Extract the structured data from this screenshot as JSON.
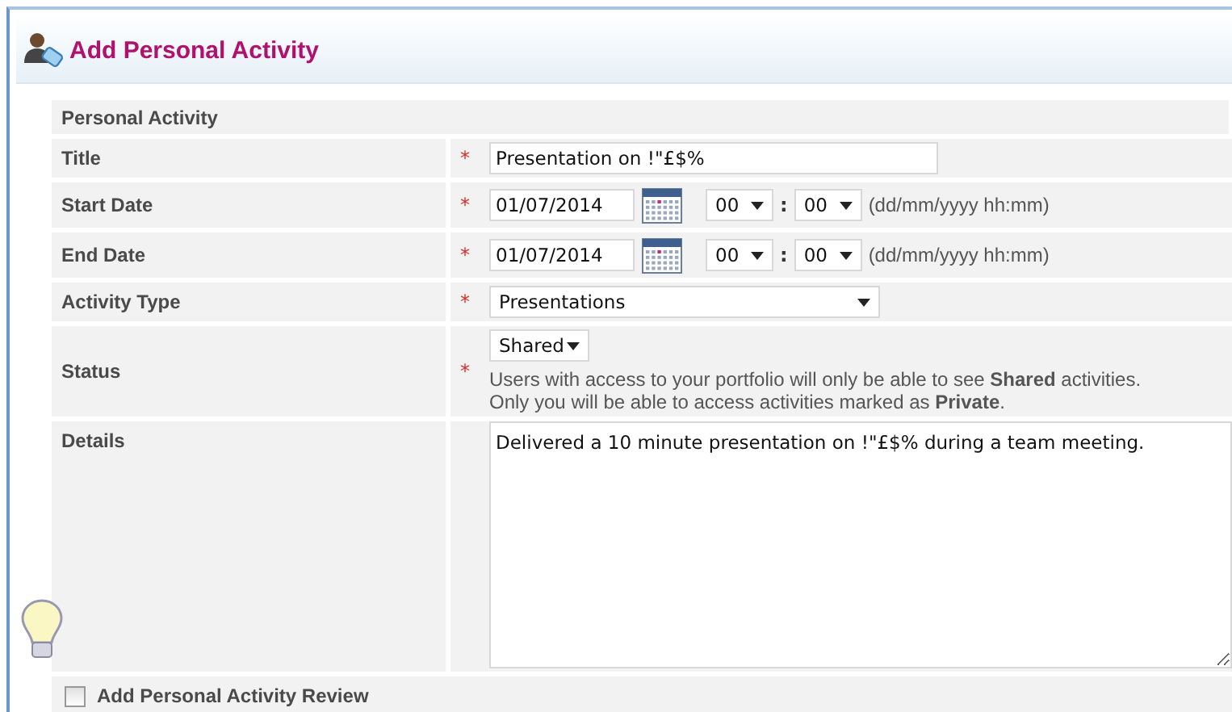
{
  "page": {
    "title": "Add Personal Activity"
  },
  "section": "Personal Activity",
  "fields": [
    {
      "kind": "text",
      "label": "Title",
      "marker": "*",
      "value": "Presentation on !\"£$%"
    },
    {
      "kind": "datetime",
      "label": "Start Date",
      "marker": "*",
      "value": "01/07/2014",
      "hour": "00",
      "minute": "00",
      "separator": ":",
      "format": "(dd/mm/yyyy hh:mm)"
    },
    {
      "kind": "datetime",
      "label": "End Date",
      "marker": "*",
      "value": "01/07/2014",
      "hour": "00",
      "minute": "00",
      "separator": ":",
      "format": "(dd/mm/yyyy hh:mm)"
    },
    {
      "kind": "select",
      "label": "Activity Type",
      "marker": "*",
      "value": "Presentations"
    },
    {
      "kind": "status",
      "label": "Status",
      "marker": "*",
      "value": "Shared",
      "note": [
        "Users with access to your portfolio will only be able to see **Shared** activities.",
        "Only you will be able to access activities marked as **Private**."
      ]
    },
    {
      "kind": "textarea",
      "label": "Details",
      "value": "Delivered a 10 minute presentation on !\"£$% during a team meeting."
    }
  ],
  "review": {
    "label": "Add Personal Activity Review",
    "checked": false
  }
}
